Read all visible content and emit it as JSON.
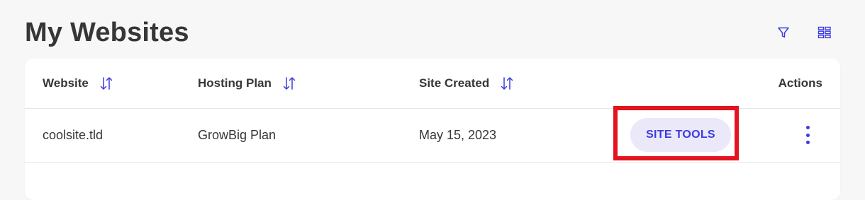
{
  "page": {
    "title": "My Websites"
  },
  "toolbar": {
    "filter_icon": "filter-icon",
    "view_icon": "grid-view-icon"
  },
  "table": {
    "columns": [
      {
        "label": "Website",
        "sortable": true
      },
      {
        "label": "Hosting Plan",
        "sortable": true
      },
      {
        "label": "Site Created",
        "sortable": true
      },
      {
        "label": "Actions",
        "sortable": false
      }
    ],
    "rows": [
      {
        "website": "coolsite.tld",
        "hosting_plan": "GrowBig Plan",
        "site_created": "May 15, 2023",
        "action_button": "SITE TOOLS",
        "menu_icon": "kebab-menu-icon"
      }
    ]
  },
  "colors": {
    "accent": "#3b3ae0",
    "button_bg": "#ebe8fa",
    "highlight": "#e3141e",
    "text": "#363636",
    "background": "#f7f7f7"
  }
}
